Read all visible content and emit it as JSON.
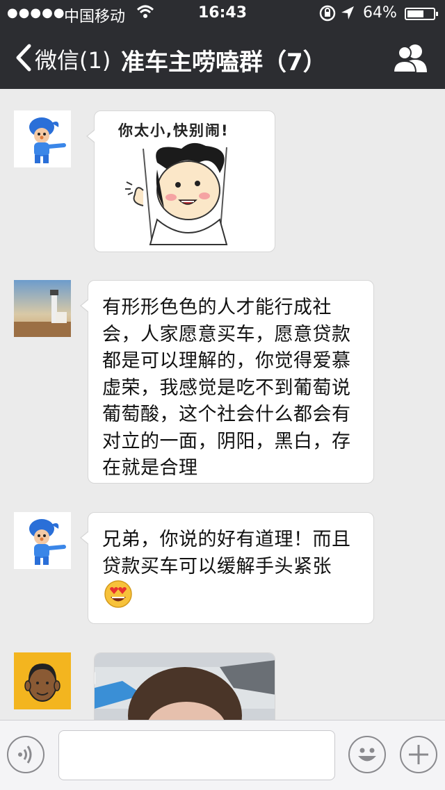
{
  "status_bar": {
    "signal": "●●●●●",
    "carrier": "中国移动",
    "time": "16:43",
    "battery_text": "64%",
    "battery_level": 0.64
  },
  "nav": {
    "back_label": "微信(1)",
    "title": "准车主唠嗑群（7）"
  },
  "messages": [
    {
      "type": "sticker",
      "avatar": "pocoyo-avatar",
      "caption": "你太小,快别闹!"
    },
    {
      "type": "text",
      "avatar": "lighthouse-avatar",
      "lines": [
        "有形形色色的人才能行成社",
        "会，人家愿意买车，愿意贷款",
        "都是可以理解的，你觉得爱慕",
        "虚荣，我感觉是吃不到葡萄说",
        "葡萄酸，这个社会什么都会有",
        "对立的一面，阴阳，黑白，存",
        "在就是合理"
      ]
    },
    {
      "type": "text",
      "avatar": "pocoyo-avatar",
      "lines": [
        "兄弟，你说的好有道理！而且",
        "贷款买车可以缓解手头紧张"
      ],
      "emoji": "heart-eyes-emoji"
    },
    {
      "type": "photo",
      "avatar": "cartoon-man-avatar"
    }
  ],
  "input_bar": {
    "voice_icon": "voice-icon",
    "emoji_icon": "smiley-icon",
    "more_icon": "plus-icon"
  },
  "colors": {
    "header_bg": "#2c2d31",
    "chat_bg": "#ebebeb",
    "bubble_bg": "#ffffff"
  }
}
